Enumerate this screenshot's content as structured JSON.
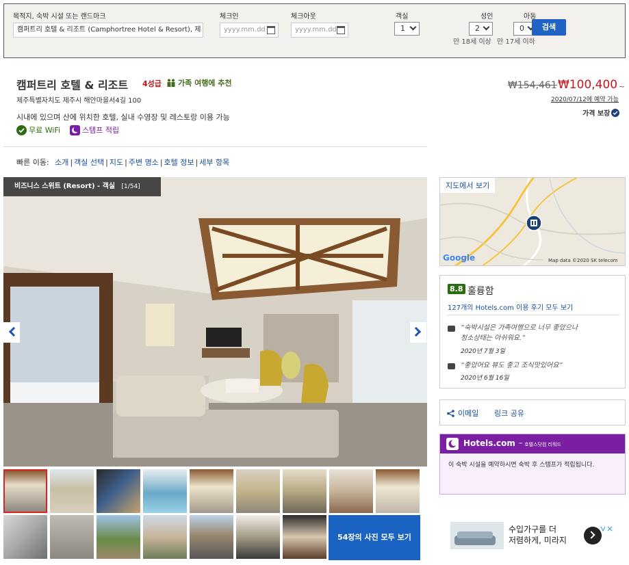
{
  "search": {
    "destination_label": "목적지, 숙박 시설 또는 랜드마크",
    "destination_value": "캠퍼트리 호텔 & 리조트 (Camphortree Hotel & Resort), 제",
    "checkin_label": "체크인",
    "checkin_placeholder": "yyyy.mm.dd",
    "checkout_label": "체크아웃",
    "checkout_placeholder": "yyyy.mm.dd",
    "rooms_label": "객실",
    "rooms_value": "1",
    "adults_label": "성인",
    "adults_value": "2",
    "adults_sub": "만 18세 이상",
    "children_label": "아동",
    "children_value": "0",
    "children_sub": "만 17세 이하",
    "search_button": "검색"
  },
  "hotel": {
    "name": "캠퍼트리 호텔 & 리조트",
    "stars": "4성급",
    "family": "가족 여행에 추천",
    "address": "제주특별자치도 제주시 해안마을서4길 100",
    "description": "시내에 있으며 산에 위치한 호텔, 실내 수영장 및 레스토랑 이용 가능",
    "amenity_wifi": "무료 WiFi",
    "amenity_stamp": "스탬프 적립"
  },
  "price": {
    "old": "₩154,461",
    "new": "₩100,400",
    "tilde": "~",
    "date_note": "2020/07/12에 예약 가능",
    "guarantee": "가격 보장"
  },
  "quicknav": {
    "label": "빠른 이동:",
    "items": [
      "소개",
      "객실 선택",
      "지도",
      "주변 명소",
      "호텔 정보",
      "세부 항목"
    ]
  },
  "gallery": {
    "caption": "비즈니스 스위트 (Resort) - 객실",
    "count": "[1/54]",
    "all_photos": "54장의 사진 모두 보기"
  },
  "map": {
    "link": "지도에서 보기",
    "google": "Google",
    "attribution": "Map data ©2020 SK telecom"
  },
  "reviews": {
    "score": "8.8",
    "word": "훌륭함",
    "link": "127개의 Hotels.com 이용 후기 모두 보기",
    "items": [
      {
        "text_1": "“숙박시설은 가족여행으로 너무 좋았으나",
        "text_2": "청소상태는 아쉬워요.”",
        "date": "2020년 7월 3일"
      },
      {
        "text_1": "“좋았어요 뷰도 좋고 조식맛있어요”",
        "text_2": "",
        "date": "2020년 6월 16일"
      }
    ]
  },
  "share": {
    "email": "이메일",
    "link": "링크 공유"
  },
  "rewards": {
    "brand": "Hotels.com",
    "tag": "™ 호텔스닷컴 리워드",
    "text": "이 숙박 시설을 예약하시면 숙박 후 스탬프가 적립됩니다."
  },
  "ad": {
    "line1": "수입가구를 더",
    "line2": "저렴하게, 미라지"
  }
}
